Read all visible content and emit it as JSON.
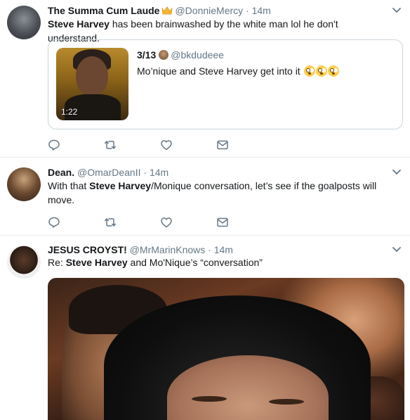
{
  "tweets": [
    {
      "name": "The Summa Cum Laude",
      "handle": "@DonnieMercy",
      "sep": "·",
      "time": "14m",
      "text_bold": "Steve Harvey",
      "text_rest": " has been brainwashed by the white man lol he don't understand.",
      "quote": {
        "name": "3/13",
        "handle": "@bkdudeee",
        "text": "Mo’nique and Steve Harvey get into it ",
        "duration": "1:22"
      }
    },
    {
      "name": "Dean.",
      "handle": "@OmarDeanII",
      "sep": "·",
      "time": "14m",
      "text_pre": "With that ",
      "text_bold": "Steve Harvey",
      "text_post": "/Monique conversation, let’s see if the goalposts will move."
    },
    {
      "name": "JESUS CROYST!",
      "handle": "@MrMarinKnows",
      "sep": "·",
      "time": "14m",
      "text_pre": "Re: ",
      "text_bold": "Steve Harvey",
      "text_post": " and Mo'Nique’s “conversation”"
    }
  ],
  "icons": {
    "reply": "reply-icon",
    "retweet": "retweet-icon",
    "like": "heart-icon",
    "dm": "envelope-icon",
    "caret": "chevron-down-icon",
    "crown": "crown-icon",
    "emoji": "flushed-face-icon"
  },
  "colors": {
    "text": "#14171a",
    "secondary": "#657786",
    "border": "#e6ecf0",
    "icon": "#657786"
  }
}
